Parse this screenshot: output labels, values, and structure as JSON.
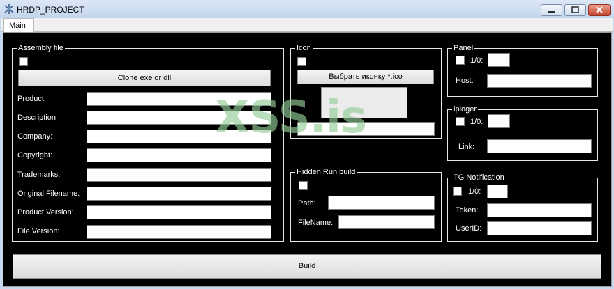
{
  "window": {
    "title": "HRDP_PROJECT"
  },
  "tabs": [
    {
      "label": "Main"
    }
  ],
  "assembly": {
    "title": "Assembly file",
    "clone_button": "Clone exe or dll",
    "fields": [
      {
        "label": "Product:",
        "value": ""
      },
      {
        "label": "Description:",
        "value": ""
      },
      {
        "label": "Company:",
        "value": ""
      },
      {
        "label": "Copyright:",
        "value": ""
      },
      {
        "label": "Trademarks:",
        "value": ""
      },
      {
        "label": "Original Filename:",
        "value": ""
      },
      {
        "label": "Product Version:",
        "value": ""
      },
      {
        "label": "File Version:",
        "value": ""
      }
    ]
  },
  "icon": {
    "title": "Icon",
    "choose_button": "Выбрать иконку *.ico",
    "path_value": ""
  },
  "hidden_run": {
    "title": "Hidden Run build",
    "path_label": "Path:",
    "path_value": "",
    "filename_label": "FileName:",
    "filename_value": ""
  },
  "panel": {
    "title": "Panel",
    "toggle_label": "1/0:",
    "toggle_value": "",
    "host_label": "Host:",
    "host_value": ""
  },
  "iploger": {
    "title": "iploger",
    "toggle_label": "1/0:",
    "toggle_value": "",
    "link_label": "Link:",
    "link_value": ""
  },
  "tg": {
    "title": "TG Notification",
    "toggle_label": "1/0:",
    "toggle_value": "",
    "token_label": "Token:",
    "token_value": "",
    "userid_label": "UserID:",
    "userid_value": ""
  },
  "build_button": "Build",
  "watermark": "XSS.is",
  "colors": {
    "background": "#000000",
    "border": "#e6e6e6",
    "text": "#ffffff",
    "watermark": "#94cd96"
  }
}
